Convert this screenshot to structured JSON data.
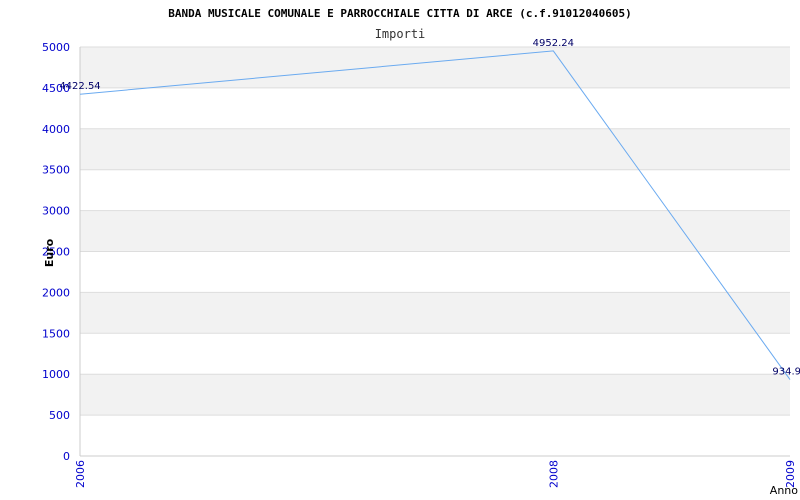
{
  "chart_data": {
    "type": "line",
    "title": "BANDA MUSICALE COMUNALE E PARROCCHIALE CITTA DI ARCE (c.f.91012040605)",
    "subtitle": "Importi",
    "xlabel": "Anno",
    "ylabel": "Euro",
    "x": [
      "2006",
      "2008",
      "2009"
    ],
    "series": [
      {
        "values": [
          4422.54,
          4952.24,
          934.9
        ],
        "labels": [
          "4422.54",
          "4952.24",
          "934.9"
        ]
      }
    ],
    "y_ticks": [
      0,
      500,
      1000,
      1500,
      2000,
      2500,
      3000,
      3500,
      4000,
      4500,
      5000
    ],
    "ylim": [
      0,
      5000
    ],
    "grid": true,
    "colors": {
      "line": "#6aaaf0",
      "tick_text": "#0000cc",
      "band": "#f2f2f2",
      "grid": "#dddddd",
      "axis": "#cccccc",
      "label_text": "#000066",
      "title_text": "#000000"
    }
  }
}
